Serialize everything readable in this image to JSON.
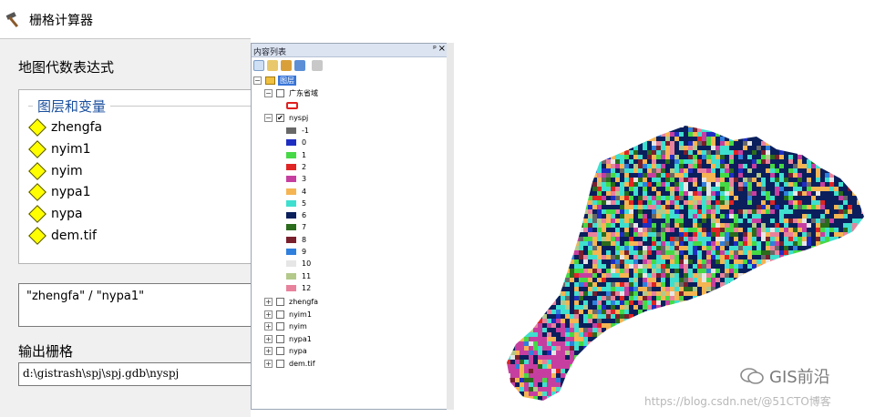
{
  "window": {
    "title": "栅格计算器",
    "icon": "hammer-icon"
  },
  "dialog": {
    "expression_label": "地图代数表达式",
    "layers_header": "图层和变量",
    "variables": [
      "zhengfa",
      "nyim1",
      "nyim",
      "nypa1",
      "nypa",
      "dem.tif"
    ],
    "expression": "\"zhengfa\" / \"nypa1\"",
    "output_label": "输出栅格",
    "output_path": "d:\\gistrash\\spj\\spj.gdb\\nyspj"
  },
  "toc": {
    "title": "内容列表",
    "pin_glyph": "ᵖ",
    "close_glyph": "×",
    "toolbar_icons": [
      "list-by-drawing-order-icon",
      "list-by-source-icon",
      "list-by-visibility-icon",
      "list-by-selection-icon",
      "options-icon"
    ],
    "root_label": "图层",
    "guangdong_layer": "广东省域",
    "nyspj_layer": "nyspj",
    "legend": [
      {
        "label": "-1",
        "color": "#686868"
      },
      {
        "label": "0",
        "color": "#1f2ec2"
      },
      {
        "label": "1",
        "color": "#45d945"
      },
      {
        "label": "2",
        "color": "#e02424"
      },
      {
        "label": "3",
        "color": "#c63fa0"
      },
      {
        "label": "4",
        "color": "#f5b553"
      },
      {
        "label": "5",
        "color": "#3fdfcf"
      },
      {
        "label": "6",
        "color": "#0a1f5c"
      },
      {
        "label": "7",
        "color": "#2a6b1c"
      },
      {
        "label": "8",
        "color": "#7a1f2c"
      },
      {
        "label": "9",
        "color": "#2f7fdd"
      },
      {
        "label": "10",
        "color": "#e6e6e6"
      },
      {
        "label": "11",
        "color": "#b3c98a"
      },
      {
        "label": "12",
        "color": "#e8829c"
      }
    ],
    "other_layers": [
      "zhengfa",
      "nyim1",
      "nyim",
      "nypa1",
      "nypa",
      "dem.tif"
    ]
  },
  "watermark": {
    "brand": "GIS前沿",
    "brand_icon": "wechat-icon",
    "credit": "https://blog.csdn.net/@51CTO博客"
  }
}
